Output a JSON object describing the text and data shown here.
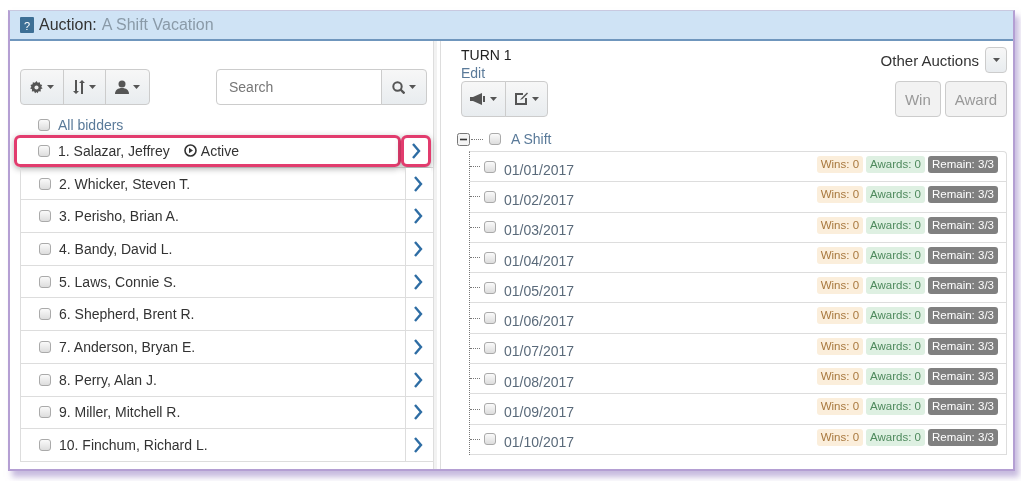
{
  "window": {
    "help_icon": "?",
    "title_label": "Auction:",
    "title": "A Shift Vacation"
  },
  "bidder_panel": {
    "search": {
      "placeholder": "Search"
    },
    "all_bidders": {
      "label": "All bidders",
      "checked": false
    },
    "bidders": [
      {
        "name": "1. Salazar, Jeffrey",
        "status": "Active",
        "checked": false,
        "highlighted": true
      },
      {
        "name": "2. Whicker, Steven T.",
        "checked": false,
        "highlighted": false
      },
      {
        "name": "3. Perisho, Brian A.",
        "checked": false,
        "highlighted": false
      },
      {
        "name": "4. Bandy, David L.",
        "checked": false,
        "highlighted": false
      },
      {
        "name": "5. Laws, Connie S.",
        "checked": false,
        "highlighted": false
      },
      {
        "name": "6. Shepherd, Brent R.",
        "checked": false,
        "highlighted": false
      },
      {
        "name": "7. Anderson, Bryan E.",
        "checked": false,
        "highlighted": false
      },
      {
        "name": "8. Perry, Alan J.",
        "checked": false,
        "highlighted": false
      },
      {
        "name": "9. Miller, Mitchell R.",
        "checked": false,
        "highlighted": false
      },
      {
        "name": "10. Finchum, Richard L.",
        "checked": false,
        "highlighted": false
      }
    ]
  },
  "turn_panel": {
    "turn": "TURN 1",
    "edit": "Edit",
    "other_auctions": "Other Auctions",
    "buttons": [
      "Win",
      "Award"
    ],
    "tree": {
      "label": "A Shift",
      "expanded": true,
      "checked": false,
      "children": [
        {
          "date": "01/01/2017",
          "checked": false,
          "badges": [
            {
              "kind": "wins",
              "text": "Wins: 0"
            },
            {
              "kind": "awards",
              "text": "Awards: 0"
            },
            {
              "kind": "remain",
              "text": "Remain: 3/3"
            }
          ]
        },
        {
          "date": "01/02/2017",
          "checked": false,
          "badges": [
            {
              "kind": "wins",
              "text": "Wins: 0"
            },
            {
              "kind": "awards",
              "text": "Awards: 0"
            },
            {
              "kind": "remain",
              "text": "Remain: 3/3"
            }
          ]
        },
        {
          "date": "01/03/2017",
          "checked": false,
          "badges": [
            {
              "kind": "wins",
              "text": "Wins: 0"
            },
            {
              "kind": "awards",
              "text": "Awards: 0"
            },
            {
              "kind": "remain",
              "text": "Remain: 3/3"
            }
          ]
        },
        {
          "date": "01/04/2017",
          "checked": false,
          "badges": [
            {
              "kind": "wins",
              "text": "Wins: 0"
            },
            {
              "kind": "awards",
              "text": "Awards: 0"
            },
            {
              "kind": "remain",
              "text": "Remain: 3/3"
            }
          ]
        },
        {
          "date": "01/05/2017",
          "checked": false,
          "badges": [
            {
              "kind": "wins",
              "text": "Wins: 0"
            },
            {
              "kind": "awards",
              "text": "Awards: 0"
            },
            {
              "kind": "remain",
              "text": "Remain: 3/3"
            }
          ]
        },
        {
          "date": "01/06/2017",
          "checked": false,
          "badges": [
            {
              "kind": "wins",
              "text": "Wins: 0"
            },
            {
              "kind": "awards",
              "text": "Awards: 0"
            },
            {
              "kind": "remain",
              "text": "Remain: 3/3"
            }
          ]
        },
        {
          "date": "01/07/2017",
          "checked": false,
          "badges": [
            {
              "kind": "wins",
              "text": "Wins: 0"
            },
            {
              "kind": "awards",
              "text": "Awards: 0"
            },
            {
              "kind": "remain",
              "text": "Remain: 3/3"
            }
          ]
        },
        {
          "date": "01/08/2017",
          "checked": false,
          "badges": [
            {
              "kind": "wins",
              "text": "Wins: 0"
            },
            {
              "kind": "awards",
              "text": "Awards: 0"
            },
            {
              "kind": "remain",
              "text": "Remain: 3/3"
            }
          ]
        },
        {
          "date": "01/09/2017",
          "checked": false,
          "badges": [
            {
              "kind": "wins",
              "text": "Wins: 0"
            },
            {
              "kind": "awards",
              "text": "Awards: 0"
            },
            {
              "kind": "remain",
              "text": "Remain: 3/3"
            }
          ]
        },
        {
          "date": "01/10/2017",
          "checked": false,
          "badges": [
            {
              "kind": "wins",
              "text": "Wins: 0"
            },
            {
              "kind": "awards",
              "text": "Awards: 0"
            },
            {
              "kind": "remain",
              "text": "Remain: 3/3"
            }
          ]
        }
      ]
    }
  }
}
